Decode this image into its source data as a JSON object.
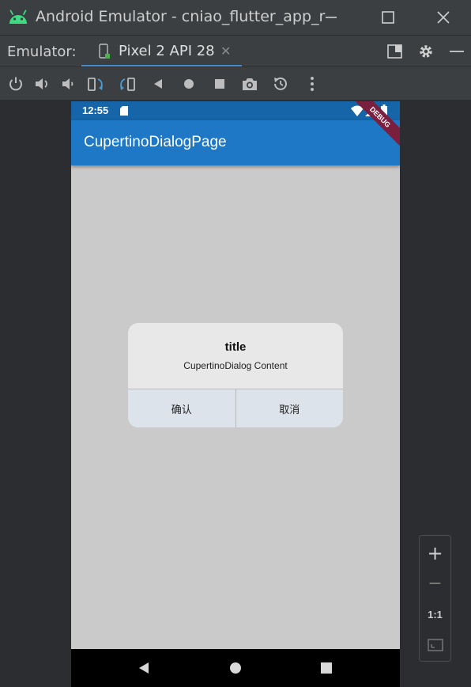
{
  "window": {
    "title": "Android Emulator - cniao_flutter_app_r",
    "minimize_icon": "minimize-icon",
    "maximize_icon": "maximize-icon",
    "close_icon": "close-icon"
  },
  "tabbar": {
    "label": "Emulator:",
    "active_tab": "Pixel 2 API 28",
    "right_icons": [
      "layout-icon",
      "gear-icon",
      "minus-icon"
    ]
  },
  "toolbar": {
    "icons": [
      "power-icon",
      "volume-up-icon",
      "volume-down-icon",
      "rotate-left-icon",
      "rotate-right-icon",
      "back-icon",
      "home-icon",
      "overview-icon",
      "camera-icon",
      "snapshot-icon",
      "more-icon"
    ]
  },
  "device": {
    "status_time": "12:55",
    "appbar_title": "CupertinoDialogPage",
    "debug_banner": "DEBUG",
    "dialog": {
      "title": "title",
      "content": "CupertinoDialog Content",
      "confirm_label": "确认",
      "cancel_label": "取消"
    }
  },
  "zoom": {
    "zoom_in": "+",
    "zoom_out": "−",
    "one_to_one": "1:1"
  },
  "colors": {
    "appbar": "#1e78c6",
    "statusbar": "#1565a8",
    "tab_underline": "#4a88c7",
    "debug_ribbon": "#7a1f3d"
  }
}
